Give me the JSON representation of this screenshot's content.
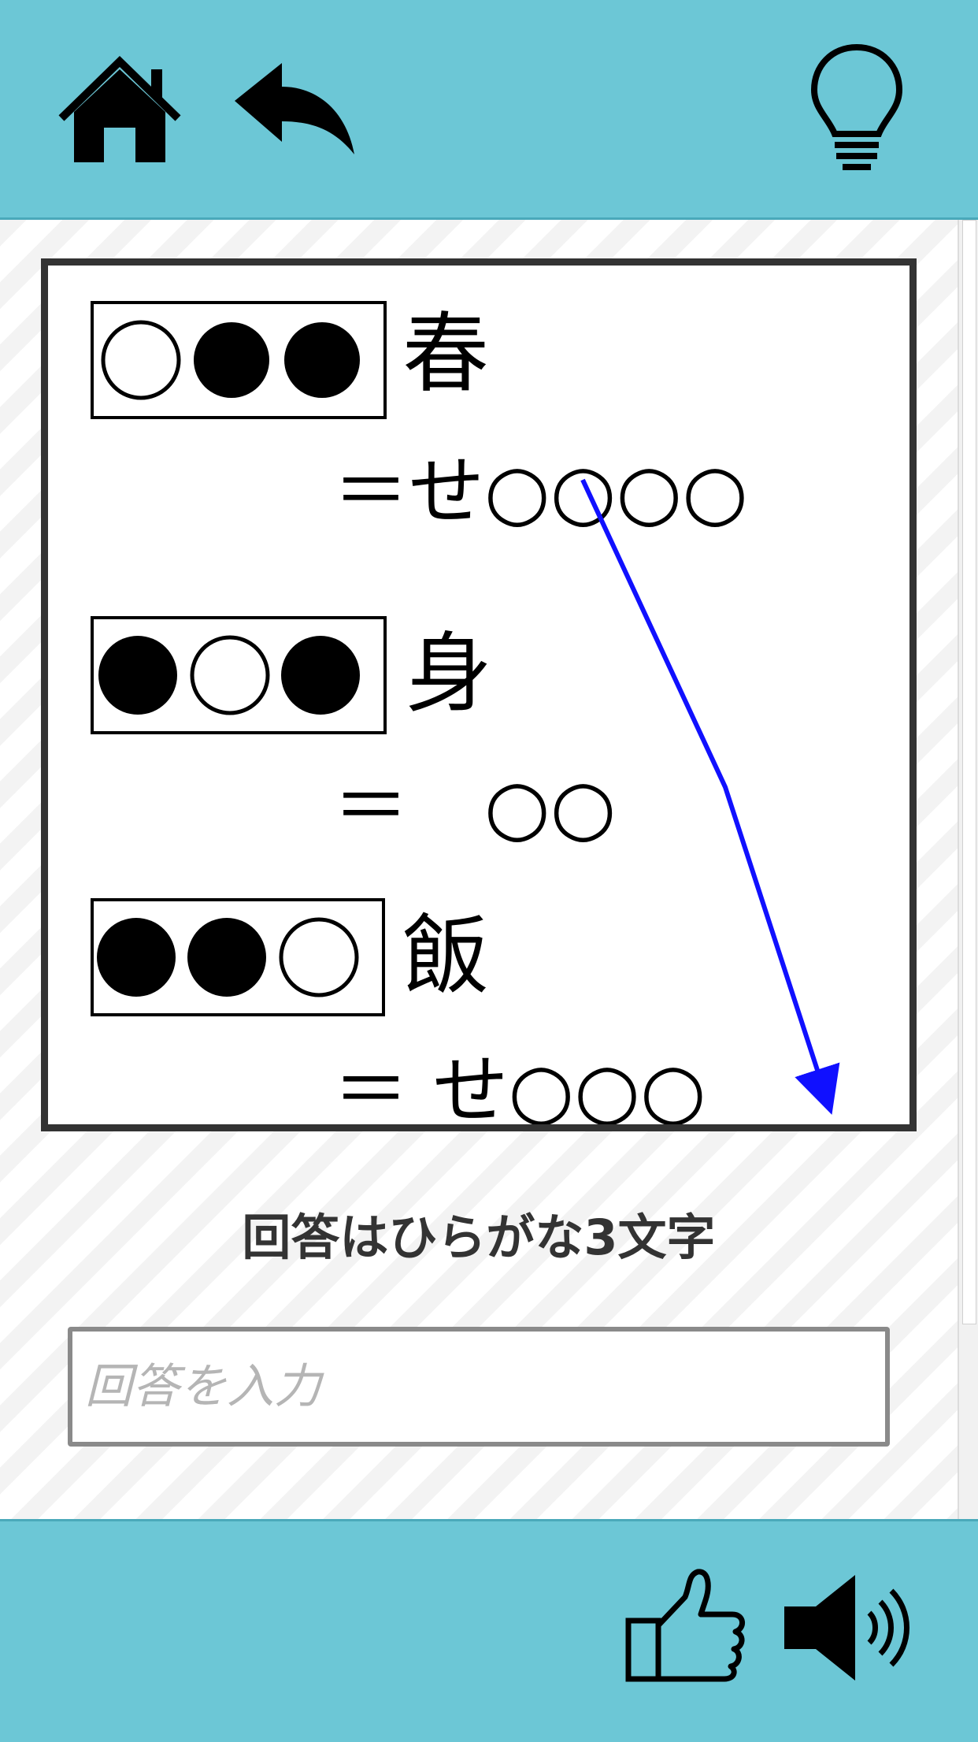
{
  "toolbar": {
    "home_icon": "home-icon",
    "back_icon": "undo-arrow-icon",
    "hint_icon": "lightbulb-icon"
  },
  "puzzle": {
    "rows": [
      {
        "pattern": "○●●",
        "kanji": "春",
        "equation": "＝せ○○○○"
      },
      {
        "pattern": "●○●",
        "kanji": "身",
        "equation": "＝　○○"
      },
      {
        "pattern": "●●○",
        "kanji": "飯",
        "equation": "＝ せ○○○"
      }
    ],
    "arrow_color": "#1010ff"
  },
  "hint": {
    "text": "回答はひらがな3文字"
  },
  "answer": {
    "placeholder": "回答を入力"
  },
  "footer": {
    "like_icon": "thumbs-up-icon",
    "sound_icon": "speaker-icon"
  },
  "colors": {
    "bar": "#6cc7d6",
    "border": "#333333"
  }
}
